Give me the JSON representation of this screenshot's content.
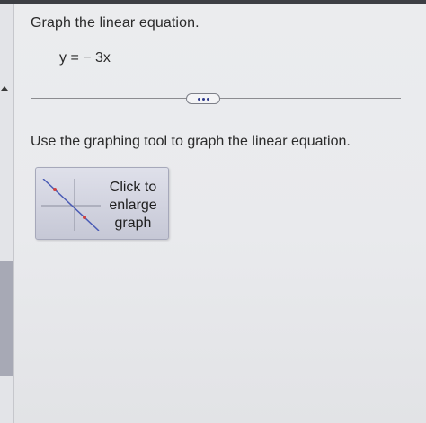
{
  "question": {
    "title": "Graph the linear equation.",
    "equation": "y = − 3x"
  },
  "divider": {
    "more_button_icon": "ellipsis-icon"
  },
  "instruction": "Use the graphing tool to graph the linear equation.",
  "enlarge_button": {
    "label": "Click to\nenlarge\ngraph",
    "icon": "graph-thumbnail-icon"
  },
  "colors": {
    "panel_background": "#eaebed",
    "scrollbar_thumb": "#a7a9b5",
    "button_background": "#d2d4e0",
    "line_color": "#4a5bb5",
    "point_color": "#d04040"
  }
}
